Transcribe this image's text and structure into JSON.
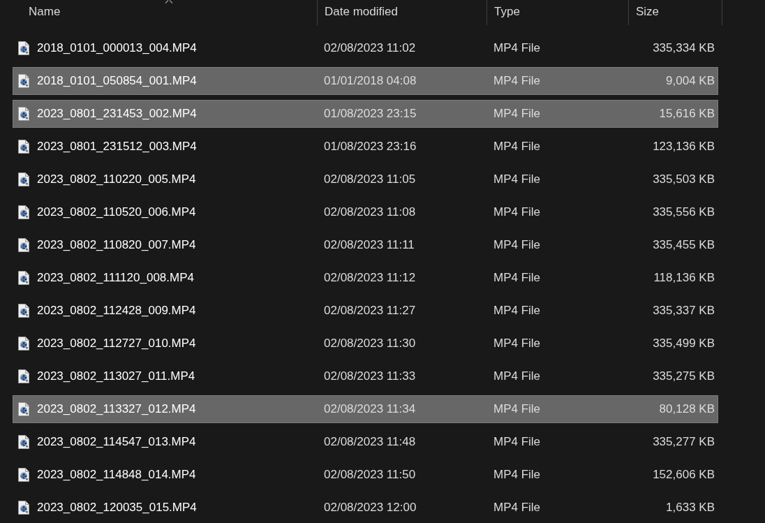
{
  "columns": [
    {
      "label": "Name",
      "sorted": true
    },
    {
      "label": "Date modified",
      "sorted": false
    },
    {
      "label": "Type",
      "sorted": false
    },
    {
      "label": "Size",
      "sorted": false
    }
  ],
  "rows": [
    {
      "name": "2018_0101_000013_004.MP4",
      "date_modified": "02/08/2023 11:02",
      "type": "MP4 File",
      "size": "335,334 KB",
      "selected": false
    },
    {
      "name": "2018_0101_050854_001.MP4",
      "date_modified": "01/01/2018 04:08",
      "type": "MP4 File",
      "size": "9,004 KB",
      "selected": true
    },
    {
      "name": "2023_0801_231453_002.MP4",
      "date_modified": "01/08/2023 23:15",
      "type": "MP4 File",
      "size": "15,616 KB",
      "selected": true
    },
    {
      "name": "2023_0801_231512_003.MP4",
      "date_modified": "01/08/2023 23:16",
      "type": "MP4 File",
      "size": "123,136 KB",
      "selected": false
    },
    {
      "name": "2023_0802_110220_005.MP4",
      "date_modified": "02/08/2023 11:05",
      "type": "MP4 File",
      "size": "335,503 KB",
      "selected": false
    },
    {
      "name": "2023_0802_110520_006.MP4",
      "date_modified": "02/08/2023 11:08",
      "type": "MP4 File",
      "size": "335,556 KB",
      "selected": false
    },
    {
      "name": "2023_0802_110820_007.MP4",
      "date_modified": "02/08/2023 11:11",
      "type": "MP4 File",
      "size": "335,455 KB",
      "selected": false
    },
    {
      "name": "2023_0802_111120_008.MP4",
      "date_modified": "02/08/2023 11:12",
      "type": "MP4 File",
      "size": "118,136 KB",
      "selected": false
    },
    {
      "name": "2023_0802_112428_009.MP4",
      "date_modified": "02/08/2023 11:27",
      "type": "MP4 File",
      "size": "335,337 KB",
      "selected": false
    },
    {
      "name": "2023_0802_112727_010.MP4",
      "date_modified": "02/08/2023 11:30",
      "type": "MP4 File",
      "size": "335,499 KB",
      "selected": false
    },
    {
      "name": "2023_0802_113027_011.MP4",
      "date_modified": "02/08/2023 11:33",
      "type": "MP4 File",
      "size": "335,275 KB",
      "selected": false
    },
    {
      "name": "2023_0802_113327_012.MP4",
      "date_modified": "02/08/2023 11:34",
      "type": "MP4 File",
      "size": "80,128 KB",
      "selected": true
    },
    {
      "name": "2023_0802_114547_013.MP4",
      "date_modified": "02/08/2023 11:48",
      "type": "MP4 File",
      "size": "335,277 KB",
      "selected": false
    },
    {
      "name": "2023_0802_114848_014.MP4",
      "date_modified": "02/08/2023 11:50",
      "type": "MP4 File",
      "size": "152,606 KB",
      "selected": false
    },
    {
      "name": "2023_0802_120035_015.MP4",
      "date_modified": "02/08/2023 12:00",
      "type": "MP4 File",
      "size": "1,633 KB",
      "selected": false
    }
  ]
}
